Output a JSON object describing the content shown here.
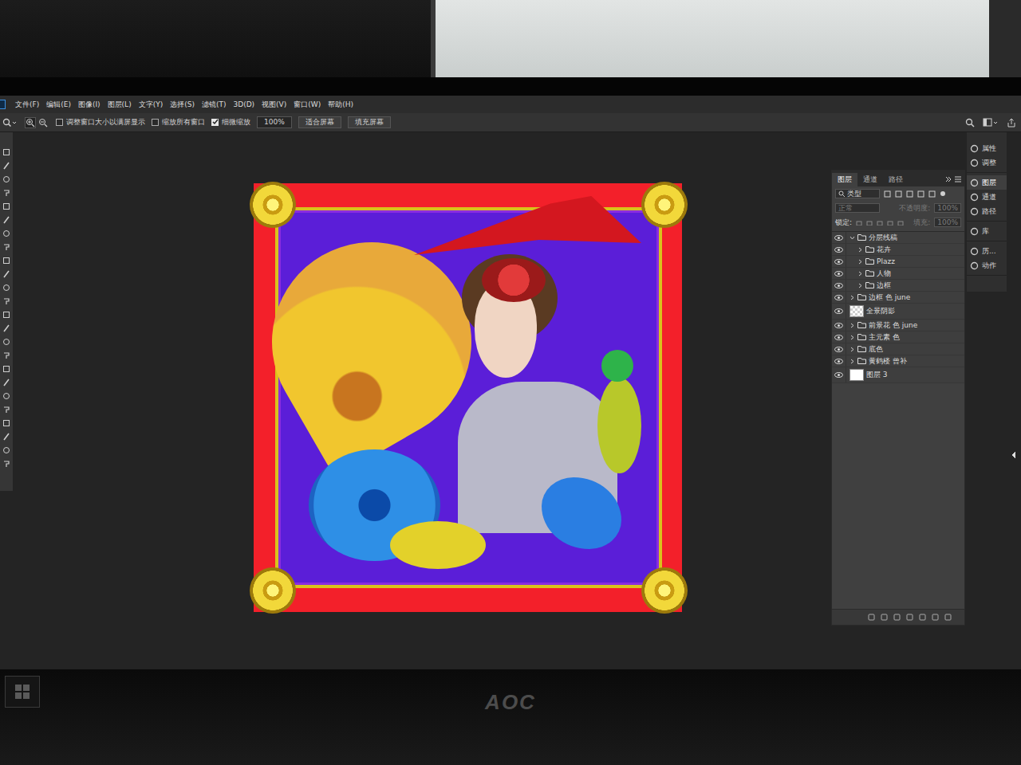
{
  "menu": [
    "文件(F)",
    "编辑(E)",
    "图像(I)",
    "图层(L)",
    "文字(Y)",
    "选择(S)",
    "滤镜(T)",
    "3D(D)",
    "视图(V)",
    "窗口(W)",
    "帮助(H)"
  ],
  "options": {
    "checkboxes": [
      {
        "label": "调整窗口大小以满屏显示",
        "checked": false
      },
      {
        "label": "缩放所有窗口",
        "checked": false
      },
      {
        "label": "细微缩放",
        "checked": true
      }
    ],
    "zoom": "100%",
    "buttons": [
      "适合屏幕",
      "填充屏幕"
    ]
  },
  "dock": [
    [
      {
        "label": "属性",
        "selected": false
      },
      {
        "label": "调整",
        "selected": false
      }
    ],
    [
      {
        "label": "图层",
        "selected": true
      },
      {
        "label": "通道",
        "selected": false
      },
      {
        "label": "路径",
        "selected": false
      }
    ],
    [
      {
        "label": "库",
        "selected": false
      }
    ],
    [
      {
        "label": "历...",
        "selected": false
      },
      {
        "label": "动作",
        "selected": false
      }
    ]
  ],
  "layers_panel": {
    "tabs": [
      {
        "label": "图层",
        "selected": true
      },
      {
        "label": "通道",
        "selected": false
      },
      {
        "label": "路径",
        "selected": false
      }
    ],
    "filter": "类型",
    "blend_mode": "正常",
    "opacity": {
      "label": "不透明度:",
      "value": "100%",
      "disabled": true
    },
    "lock_label": "锁定:",
    "fill": {
      "label": "填充:",
      "value": "100%",
      "disabled": true
    },
    "layers": [
      {
        "name": "分层线稿",
        "kind": "group",
        "visible": true,
        "expanded": true,
        "children": [
          {
            "name": "花卉",
            "kind": "group",
            "visible": true,
            "expanded": false
          },
          {
            "name": "Plazz",
            "kind": "group",
            "visible": true,
            "expanded": false
          },
          {
            "name": "人物",
            "kind": "group",
            "visible": true,
            "expanded": false
          },
          {
            "name": "边框",
            "kind": "group",
            "visible": true,
            "expanded": false
          }
        ]
      },
      {
        "name": "边框 色 june",
        "kind": "group",
        "visible": true,
        "expanded": false
      },
      {
        "name": "全景阴影",
        "kind": "clear",
        "visible": true
      },
      {
        "name": "前景花 色 june",
        "kind": "group",
        "visible": true,
        "expanded": false
      },
      {
        "name": "主元素 色",
        "kind": "group",
        "visible": true,
        "expanded": false
      },
      {
        "name": "底色",
        "kind": "group",
        "visible": true,
        "expanded": false
      },
      {
        "name": "黄鹤楼 曾补",
        "kind": "group",
        "visible": true,
        "expanded": false
      },
      {
        "name": "图层 3",
        "kind": "solid",
        "visible": true
      }
    ]
  },
  "monitor": {
    "brand": "AOC"
  }
}
